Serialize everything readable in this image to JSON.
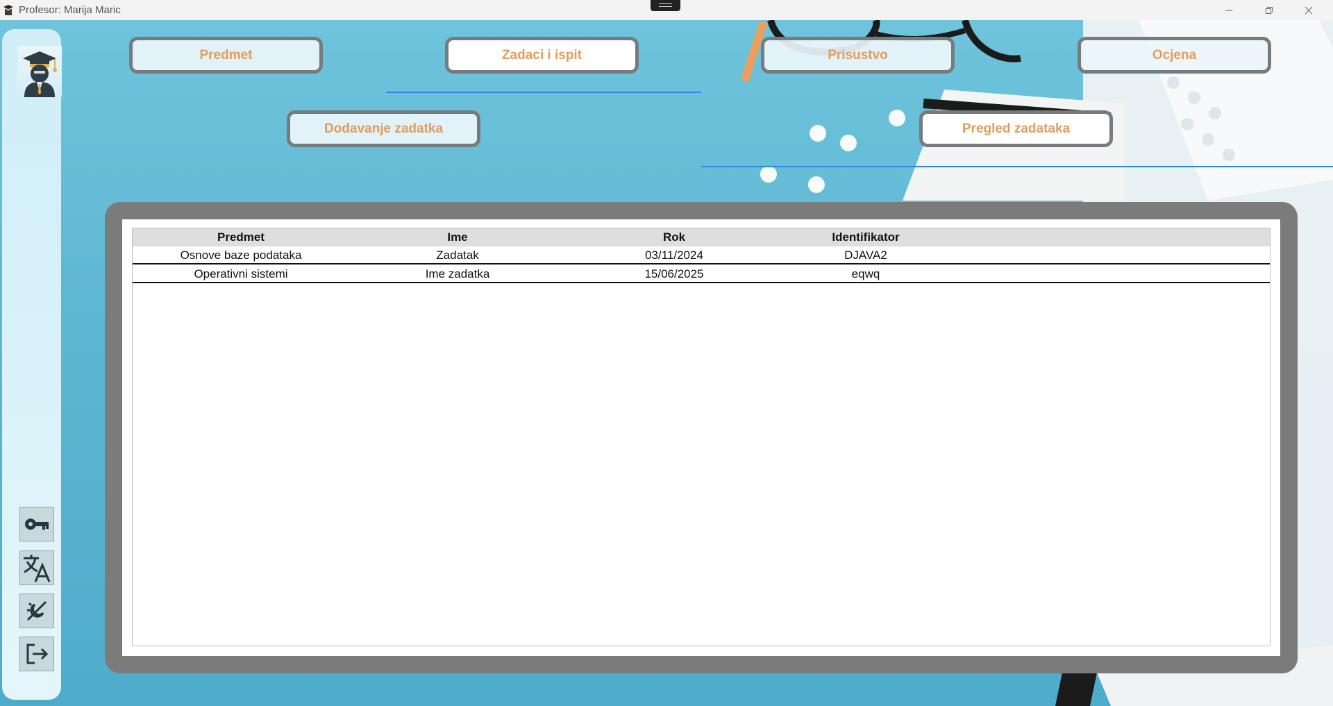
{
  "window": {
    "title": "Profesor: Marija Maric"
  },
  "tabs": {
    "predmet": "Predmet",
    "zadaci": "Zadaci i ispit",
    "prisustvo": "Prisustvo",
    "ocjena": "Ocjena",
    "active": "Zadaci i ispit"
  },
  "subtabs": {
    "dodavanje": "Dodavanje zadatka",
    "pregled": "Pregled zadataka",
    "active": "Pregled zadataka"
  },
  "sidebar": {
    "icons": [
      "key-icon",
      "translate-icon",
      "theme-toggle-icon",
      "logout-icon"
    ]
  },
  "table": {
    "columns": [
      "Predmet",
      "Ime",
      "Rok",
      "Identifikator"
    ],
    "rows": [
      [
        "Osnove baze podataka",
        "Zadatak",
        "03/11/2024",
        "DJAVA2"
      ],
      [
        "Operativni sistemi",
        "Ime zadatka",
        "15/06/2025",
        "eqwq"
      ]
    ]
  },
  "colors": {
    "accent_text": "#e39c5c",
    "underline": "#2e86de",
    "panel": "#7b7b7b"
  }
}
